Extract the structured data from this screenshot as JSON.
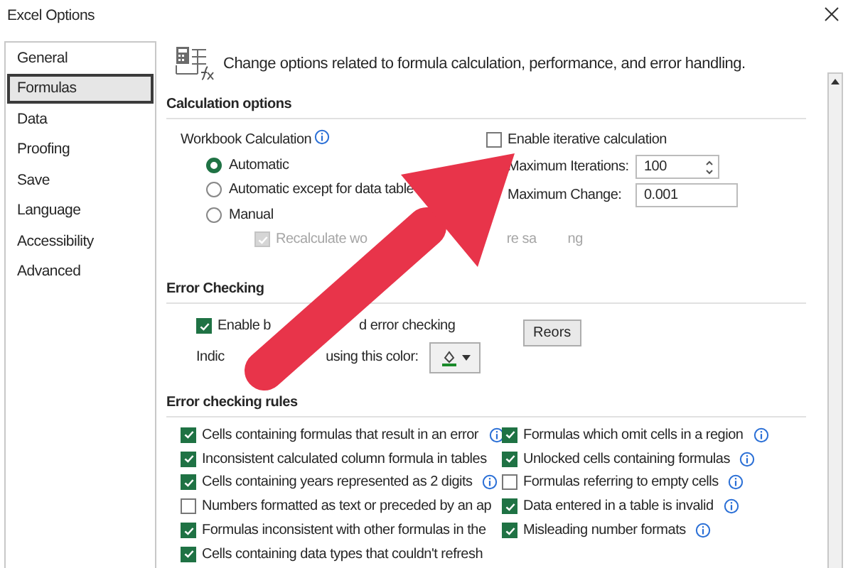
{
  "window": {
    "title": "Excel Options"
  },
  "sidebar": {
    "items": [
      {
        "label": "General",
        "selected": false
      },
      {
        "label": "Formulas",
        "selected": true
      },
      {
        "label": "Data",
        "selected": false
      },
      {
        "label": "Proofing",
        "selected": false
      },
      {
        "label": "Save",
        "selected": false
      },
      {
        "label": "Language",
        "selected": false
      },
      {
        "label": "Accessibility",
        "selected": false
      },
      {
        "label": "Advanced",
        "selected": false
      }
    ]
  },
  "header": {
    "text": "Change options related to formula calculation, performance, and error handling."
  },
  "calculation_options": {
    "title": "Calculation options",
    "workbook_calculation": {
      "label": "Workbook Calculation",
      "options": [
        {
          "label": "Automatic",
          "selected": true
        },
        {
          "label": "Automatic except for data table",
          "selected": false
        },
        {
          "label": "Manual",
          "selected": false
        }
      ],
      "recalculate": {
        "label_parts": [
          "Recalculate wo",
          "re sa",
          "ng"
        ],
        "checked": true,
        "disabled": true
      }
    },
    "iterative": {
      "label": "Enable iterative calculation",
      "checked": false,
      "max_iterations": {
        "label": "Maximum Iterations:",
        "value": "100"
      },
      "max_change": {
        "label": "Maximum Change:",
        "value": "0.001"
      }
    }
  },
  "error_checking": {
    "title": "Error Checking",
    "enable": {
      "label_parts": [
        "Enable b",
        "d error checking"
      ],
      "checked": true
    },
    "indicator": {
      "label_parts": [
        "Indic",
        "using this color:"
      ]
    },
    "reset_button": "Reors"
  },
  "error_checking_rules": {
    "title": "Error checking rules",
    "left_column": [
      {
        "label": "Cells containing formulas that result in an error",
        "checked": true,
        "info": true
      },
      {
        "label": "Inconsistent calculated column formula in tables",
        "checked": true,
        "info": false
      },
      {
        "label": "Cells containing years represented as 2 digits",
        "checked": true,
        "info": true
      },
      {
        "label": "Numbers formatted as text or preceded by an ap",
        "checked": false,
        "info": false
      },
      {
        "label": "Formulas inconsistent with other formulas in the",
        "checked": true,
        "info": false
      },
      {
        "label": "Cells containing data types that couldn't refresh",
        "checked": true,
        "info": false
      }
    ],
    "right_column": [
      {
        "label": "Formulas which omit cells in a region",
        "checked": true,
        "info": true
      },
      {
        "label": "Unlocked cells containing formulas",
        "checked": true,
        "info": true
      },
      {
        "label": "Formulas referring to empty cells",
        "checked": false,
        "info": true
      },
      {
        "label": "Data entered in a table is invalid",
        "checked": true,
        "info": true
      },
      {
        "label": "Misleading number formats",
        "checked": true,
        "info": true
      }
    ]
  }
}
